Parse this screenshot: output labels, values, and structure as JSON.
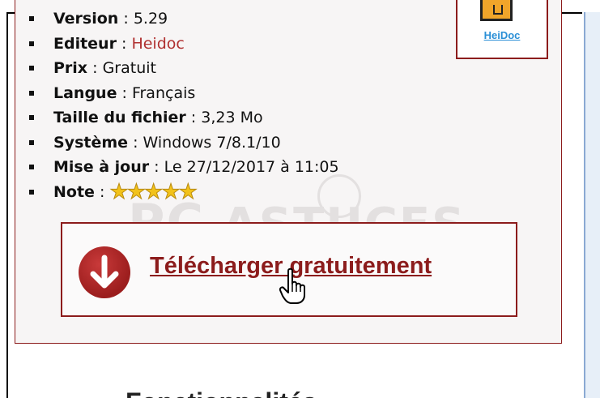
{
  "specs": [
    {
      "key": "Version",
      "value": "5.29"
    },
    {
      "key": "Editeur",
      "value": "Heidoc"
    },
    {
      "key": "Prix",
      "value": "Gratuit"
    },
    {
      "key": "Langue",
      "value": "Français"
    },
    {
      "key": "Taille du fichier",
      "value": "3,23 Mo"
    },
    {
      "key": "Système",
      "value": "Windows 7/8.1/10"
    },
    {
      "key": "Mise à jour",
      "value": "Le 27/12/2017 à 11:05"
    },
    {
      "key": "Note",
      "value": ""
    }
  ],
  "separator": " : ",
  "rating": {
    "stars": 5,
    "glyphs": "★★★★★"
  },
  "logo": {
    "text": "HeiDoc"
  },
  "download": {
    "label": "Télécharger gratuitement",
    "icon": "download-arrow-icon"
  },
  "watermark": {
    "text_pc": "PC",
    "text_rest": "ASTUCES"
  },
  "bottom_heading": {
    "text": "Fonctionnalités"
  },
  "colors": {
    "accent": "#8c1c1c",
    "link": "#b03030",
    "star": "#f2c21a",
    "panel": "#e7eff8"
  }
}
